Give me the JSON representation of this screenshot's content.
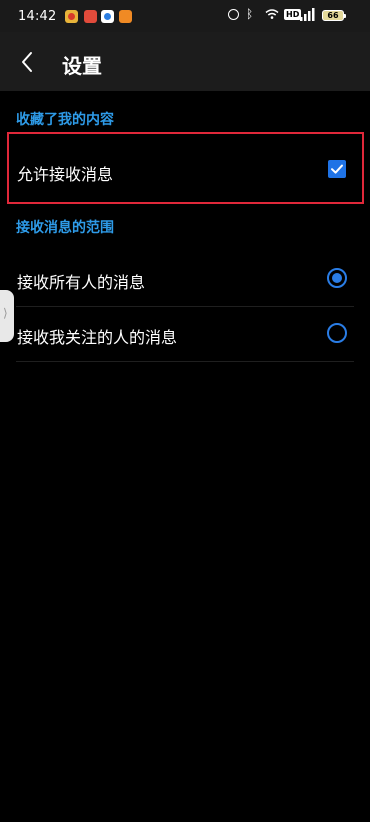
{
  "status_bar": {
    "time": "14:42",
    "battery": "66"
  },
  "header": {
    "title": "设置"
  },
  "sections": [
    {
      "label": "收藏了我的内容",
      "items": [
        {
          "label": "允许接收消息",
          "checked": true
        }
      ]
    },
    {
      "label": "接收消息的范围",
      "items": [
        {
          "label": "接收所有人的消息",
          "selected": true
        },
        {
          "label": "接收我关注的人的消息",
          "selected": false
        }
      ]
    }
  ],
  "colors": {
    "accent": "#2a7de6",
    "section_label": "#2e9be8",
    "highlight_border": "#e0283a"
  }
}
